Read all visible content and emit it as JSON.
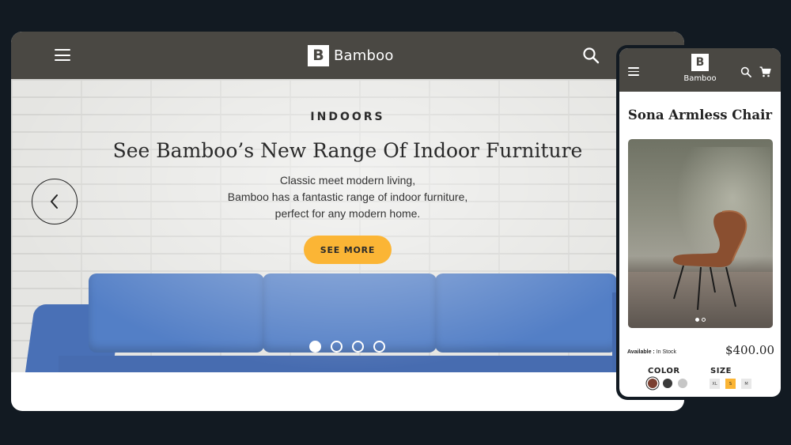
{
  "desktop": {
    "header": {
      "brand": "Bamboo",
      "logo_letter": "B",
      "menu_icon": "hamburger-menu-icon",
      "search_icon": "search-icon"
    },
    "hero": {
      "eyebrow": "INDOORS",
      "headline": "See Bamboo’s New Range Of Indoor Furniture",
      "subtext_lines": [
        "Classic meet modern living,",
        "Bamboo has a fantastic range of indoor furniture,",
        "perfect for any modern home."
      ],
      "cta_label": "SEE MORE",
      "prev_icon": "chevron-left-icon",
      "slides_total": 4,
      "active_slide": 1
    }
  },
  "mobile": {
    "header": {
      "brand": "Bamboo",
      "logo_letter": "B",
      "menu_icon": "hamburger-menu-icon",
      "search_icon": "search-icon",
      "cart_icon": "cart-icon"
    },
    "product": {
      "title": "Sona Armless Chair",
      "image_slides_total": 2,
      "active_image_slide": 1,
      "availability_label": "Available :",
      "availability_value": "In Stock",
      "price": "$400.00",
      "color_label": "COLOR",
      "colors": [
        "#7a3f30",
        "#3a3a3a",
        "#c6c6c6"
      ],
      "selected_color": 0,
      "size_label": "SIZE",
      "sizes": [
        "XL",
        "S",
        "M"
      ],
      "selected_size": "S"
    }
  },
  "theme": {
    "header_bg": "#4a4843",
    "accent": "#fbb535",
    "page_bg": "#121a22"
  }
}
